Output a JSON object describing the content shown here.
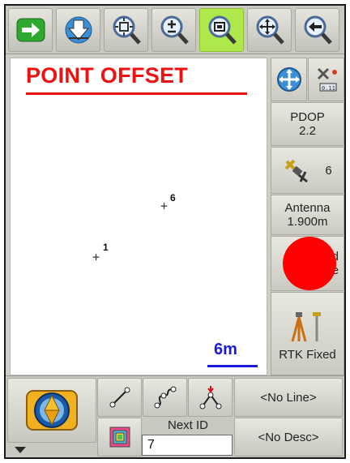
{
  "toolbar": {
    "buttons": [
      {
        "name": "next-arrow-button",
        "icon": "green-arrow-right-icon"
      },
      {
        "name": "download-button",
        "icon": "download-arrow-icon"
      },
      {
        "name": "zoom-extents-button",
        "icon": "zoom-extents-icon"
      },
      {
        "name": "zoom-in-out-button",
        "icon": "zoom-plus-minus-icon"
      },
      {
        "name": "zoom-window-button",
        "icon": "zoom-window-icon",
        "active": true
      },
      {
        "name": "pan-button",
        "icon": "pan-icon"
      },
      {
        "name": "back-button",
        "icon": "back-arrow-icon"
      }
    ]
  },
  "map": {
    "title": "POINT OFFSET",
    "points": [
      {
        "id": "6"
      },
      {
        "id": "1"
      }
    ],
    "scale_label": "6m"
  },
  "right_panel": {
    "pdop_label": "PDOP",
    "pdop_value": "2.2",
    "satellites": "6",
    "antenna_label": "Antenna",
    "antenna_value": "1.900m",
    "obscured_line1": "d",
    "obscured_line2": "e",
    "rtk_status": "RTK Fixed"
  },
  "bottom": {
    "line_button": "<No Line>",
    "desc_button": "<No Desc>",
    "next_id_label": "Next ID",
    "next_id_value": "7"
  },
  "colors": {
    "title_red": "#ee1111",
    "scale_blue": "#1a1ad8",
    "active_green": "#aee84a",
    "red_dot": "#ff0000"
  }
}
